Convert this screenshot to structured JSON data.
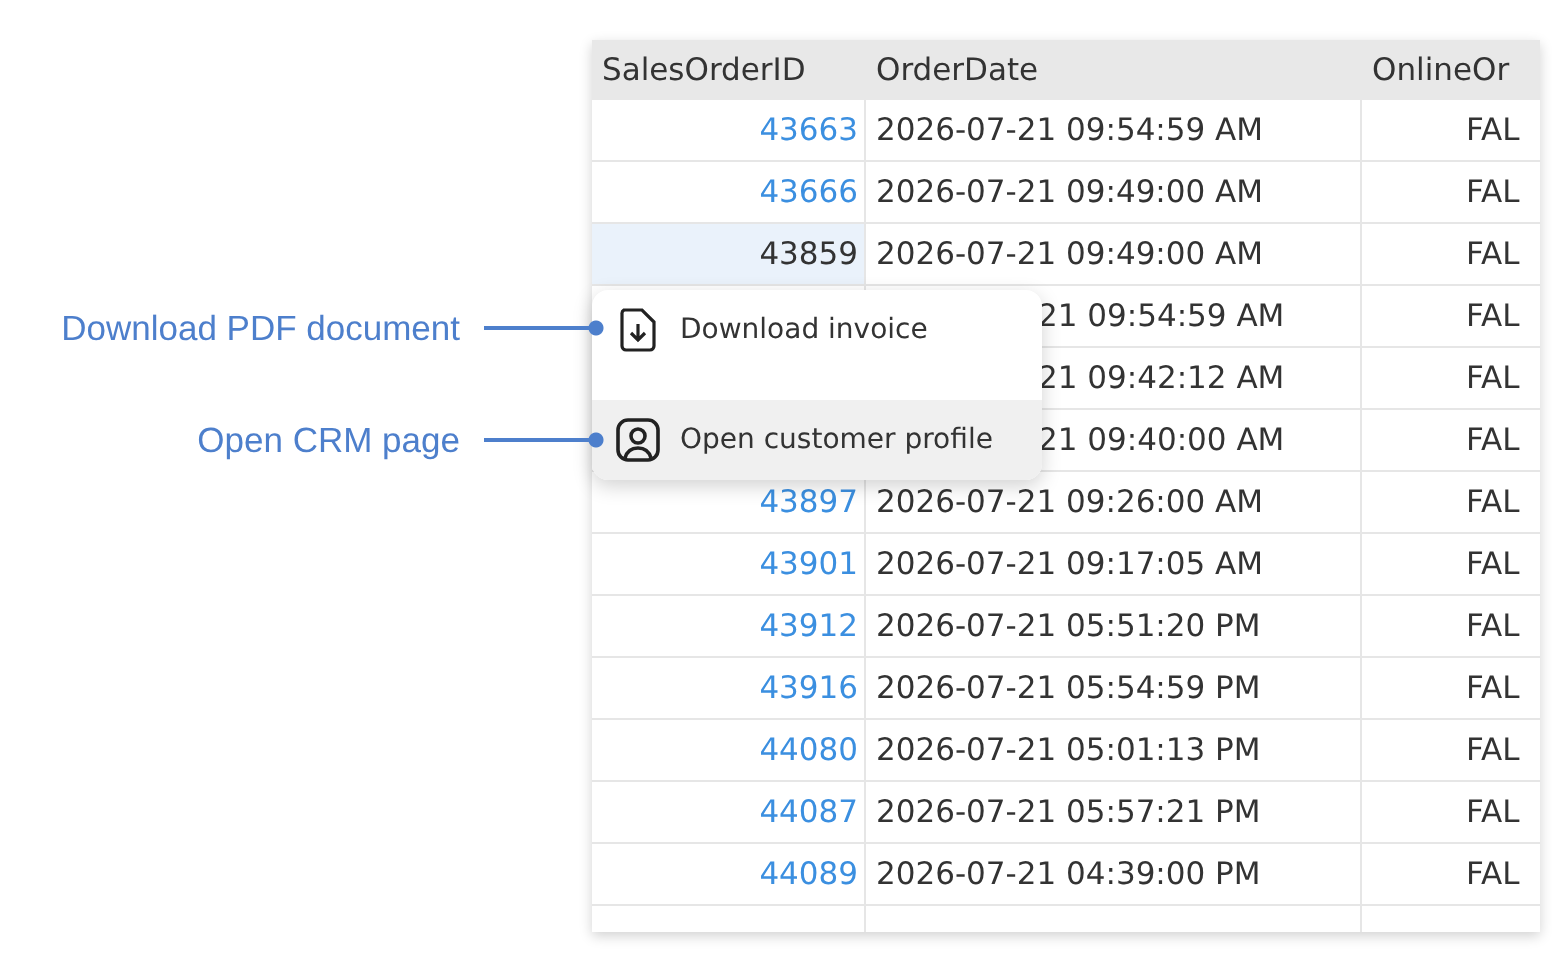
{
  "table": {
    "columns": [
      "SalesOrderID",
      "OrderDate",
      "OnlineOr"
    ],
    "rows": [
      {
        "id": "43663",
        "link": true,
        "selected": false,
        "order_date": "2026-07-21 09:54:59 AM",
        "online": "FAL"
      },
      {
        "id": "43666",
        "link": true,
        "selected": false,
        "order_date": "2026-07-21 09:49:00 AM",
        "online": "FAL"
      },
      {
        "id": "43859",
        "link": false,
        "selected": true,
        "order_date": "2026-07-21 09:49:00 AM",
        "online": "FAL"
      },
      {
        "covered": true,
        "order_date": "21 09:54:59 AM",
        "online": "FAL"
      },
      {
        "covered": true,
        "order_date": "21 09:42:12 AM",
        "online": "FAL"
      },
      {
        "covered": true,
        "order_date": "21 09:40:00 AM",
        "online": "FAL"
      },
      {
        "id": "43897",
        "link": true,
        "selected": false,
        "order_date": "2026-07-21 09:26:00 AM",
        "online": "FAL"
      },
      {
        "id": "43901",
        "link": true,
        "selected": false,
        "order_date": "2026-07-21 09:17:05 AM",
        "online": "FAL"
      },
      {
        "id": "43912",
        "link": true,
        "selected": false,
        "order_date": "2026-07-21 05:51:20 PM",
        "online": "FAL"
      },
      {
        "id": "43916",
        "link": true,
        "selected": false,
        "order_date": "2026-07-21 05:54:59 PM",
        "online": "FAL"
      },
      {
        "id": "44080",
        "link": true,
        "selected": false,
        "order_date": "2026-07-21 05:01:13 PM",
        "online": "FAL"
      },
      {
        "id": "44087",
        "link": true,
        "selected": false,
        "order_date": "2026-07-21 05:57:21 PM",
        "online": "FAL"
      },
      {
        "id": "44089",
        "link": true,
        "selected": false,
        "order_date": "2026-07-21 04:39:00 PM",
        "online": "FAL"
      }
    ]
  },
  "context_menu": {
    "items": [
      {
        "kind": "document",
        "label": "Download invoice",
        "selected": false,
        "callout": "Download PDF document"
      },
      {
        "kind": "user",
        "label": "Open customer profile",
        "selected": true,
        "callout": "Open CRM page"
      }
    ]
  }
}
